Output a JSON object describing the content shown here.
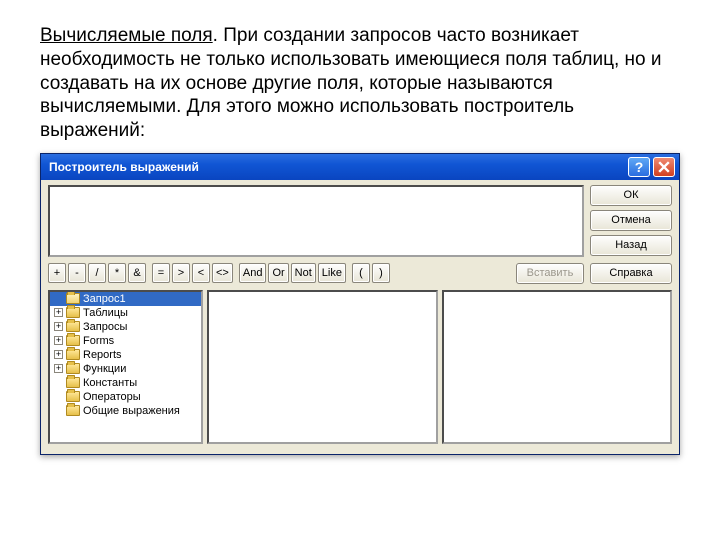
{
  "intro": {
    "caption": "Вычисляемые поля",
    "text": ". При создании запросов часто возникает необходимость не только использовать имеющиеся поля таблиц, но и создавать на их основе другие поля, которые называются вычисляемыми.  Для этого можно использовать построитель выражений:"
  },
  "window": {
    "title": "Построитель выражений",
    "buttons": {
      "ok": "ОК",
      "cancel": "Отмена",
      "back": "Назад",
      "insert": "Вставить",
      "help": "Справка"
    },
    "operators": {
      "g1": [
        "+",
        "-",
        "/",
        "*",
        "&"
      ],
      "g2": [
        "=",
        ">",
        "<",
        "<>"
      ],
      "g3": [
        "And",
        "Or",
        "Not",
        "Like"
      ],
      "g4": [
        "(",
        ")"
      ]
    },
    "tree": [
      {
        "label": "Запрос1",
        "expand": "none",
        "open": true,
        "selected": true
      },
      {
        "label": "Таблицы",
        "expand": "plus"
      },
      {
        "label": "Запросы",
        "expand": "plus"
      },
      {
        "label": "Forms",
        "expand": "plus"
      },
      {
        "label": "Reports",
        "expand": "plus"
      },
      {
        "label": "Функции",
        "expand": "plus"
      },
      {
        "label": "Константы",
        "expand": "none"
      },
      {
        "label": "Операторы",
        "expand": "none"
      },
      {
        "label": "Общие выражения",
        "expand": "none"
      }
    ]
  }
}
